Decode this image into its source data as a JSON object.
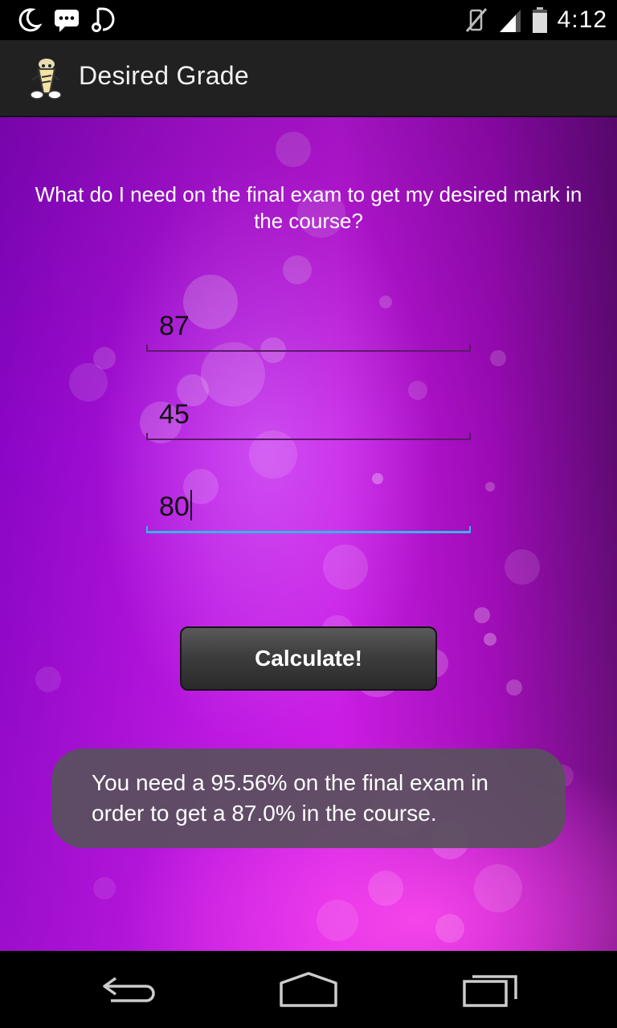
{
  "status_bar": {
    "time": "4:12",
    "icons_left": [
      "moon-icon",
      "chat-icon",
      "music-note-icon"
    ],
    "icons_right": [
      "vibrate-off-icon",
      "signal-icon",
      "battery-icon"
    ]
  },
  "action_bar": {
    "title": "Desired Grade",
    "app_icon": "pencil-character-icon"
  },
  "main": {
    "question": "What do I need on the final exam to get my desired mark in the course?",
    "fields": [
      {
        "value": "87"
      },
      {
        "value": "45"
      },
      {
        "value": "80"
      }
    ],
    "calculate_label": "Calculate!",
    "result_message": "You need a 95.56% on the final exam in order to get a 87.0% in the course."
  },
  "nav_bar": {
    "icons": [
      "back-icon",
      "home-icon",
      "recent-apps-icon"
    ]
  },
  "colors": {
    "accent": "#33b5e5",
    "background_primary": "#b715e0",
    "action_bar": "#212121"
  }
}
